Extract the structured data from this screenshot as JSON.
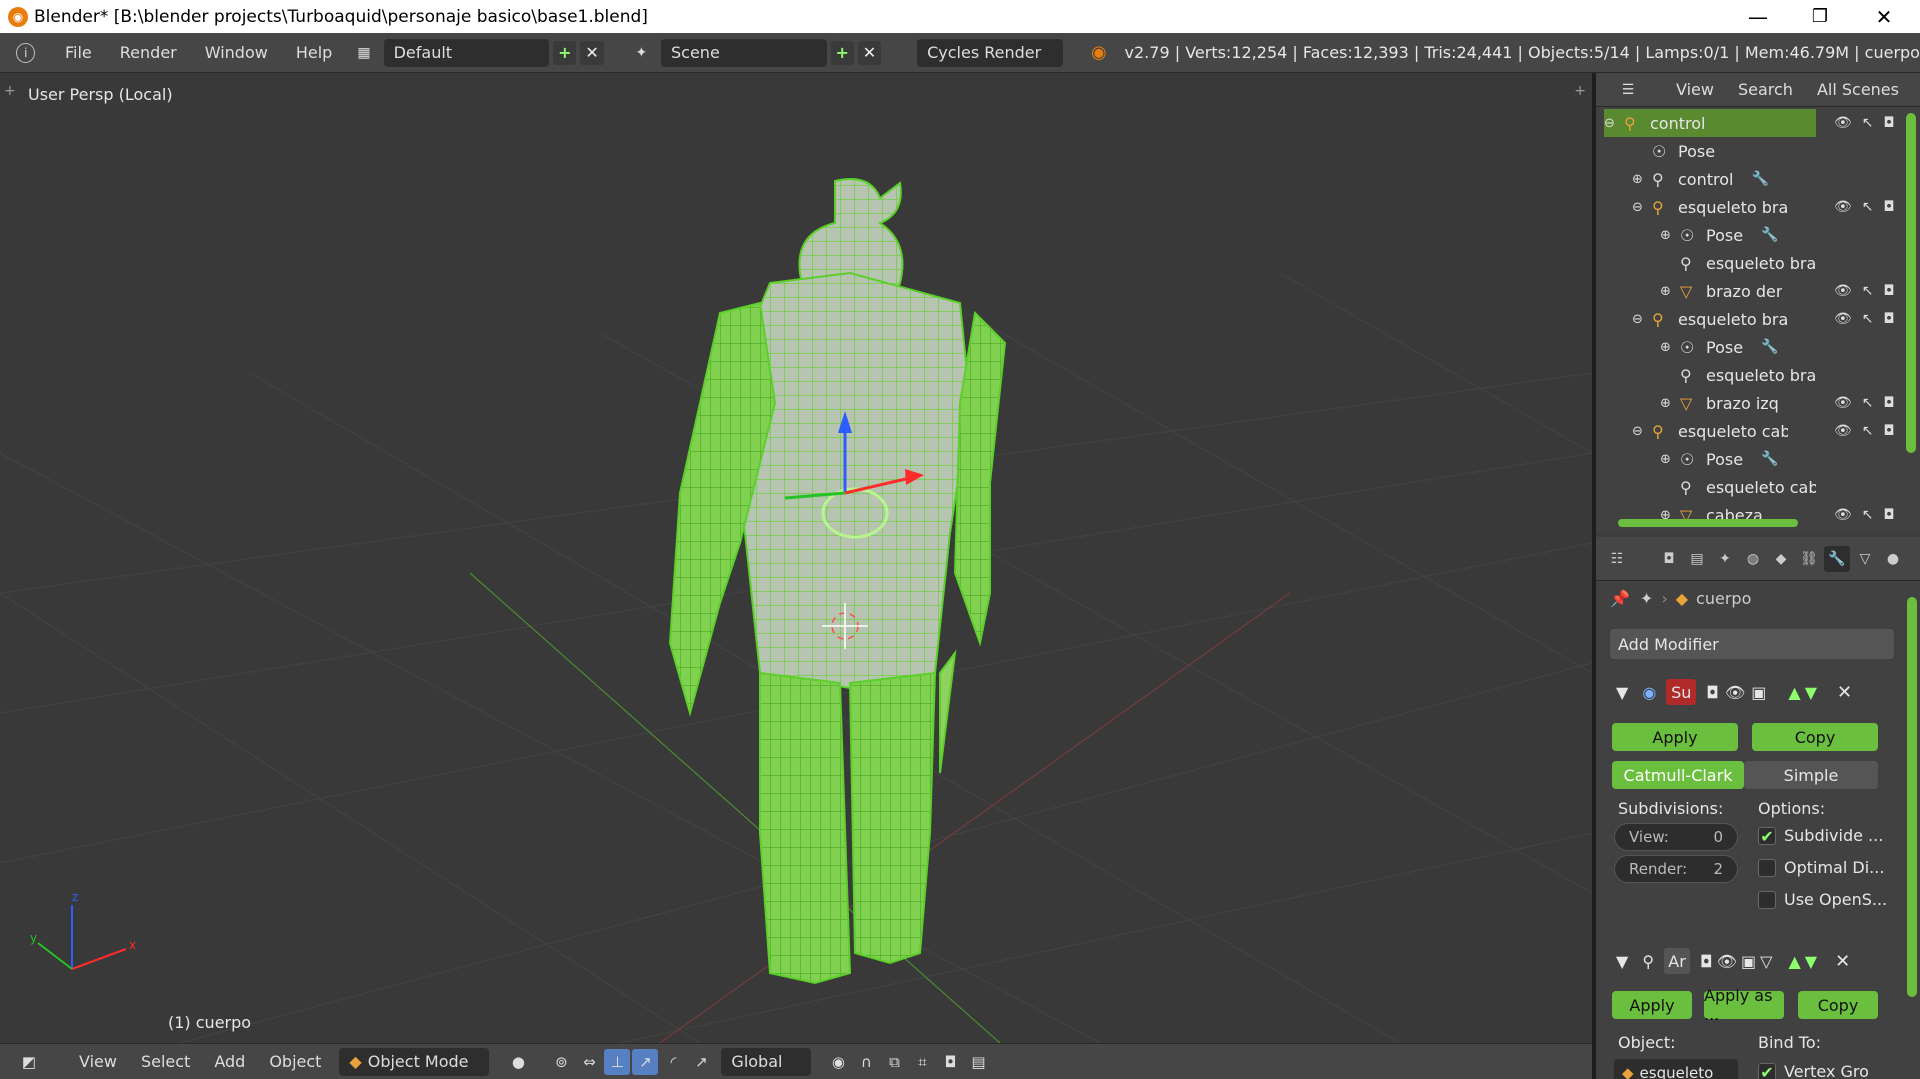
{
  "window": {
    "title": "Blender* [B:\\blender projects\\Turboaquid\\personaje basico\\base1.blend]",
    "minimize": "—",
    "maximize": "❐",
    "close": "✕"
  },
  "topbar": {
    "menus": [
      "File",
      "Render",
      "Window",
      "Help"
    ],
    "layout": "Default",
    "scene": "Scene",
    "engine": "Cycles Render",
    "stats": "v2.79 | Verts:12,254 | Faces:12,393 | Tris:24,441 | Objects:5/14 | Lamps:0/1 | Mem:46.79M | cuerpo",
    "add": "+",
    "remove": "✕"
  },
  "viewport": {
    "label": "User Persp (Local)",
    "object": "(1) cuerpo",
    "axes": {
      "x": "x",
      "y": "y",
      "z": "z"
    },
    "accent": "#7bd44a"
  },
  "bottombar": {
    "menus": [
      "View",
      "Select",
      "Add",
      "Object"
    ],
    "mode": "Object Mode",
    "orientation": "Global"
  },
  "outliner": {
    "tabs": [
      "View",
      "Search",
      "All Scenes"
    ],
    "rows": [
      {
        "label": "control",
        "indent": 0,
        "icon": "armature-icon",
        "selected": true,
        "expander": "⊖",
        "vis": true
      },
      {
        "label": "Pose",
        "indent": 1,
        "icon": "pose-icon",
        "selected": false,
        "expander": "",
        "vis": false
      },
      {
        "label": "control",
        "indent": 1,
        "icon": "armature-data-icon",
        "selected": false,
        "expander": "⊕",
        "vis": false,
        "extra": "wrench"
      },
      {
        "label": "esqueleto brazo de",
        "indent": 1,
        "icon": "armature-icon",
        "selected": false,
        "expander": "⊖",
        "vis": true
      },
      {
        "label": "Pose",
        "indent": 2,
        "icon": "pose-icon",
        "selected": false,
        "expander": "⊕",
        "vis": false,
        "extra": "wrench"
      },
      {
        "label": "esqueleto braz",
        "indent": 2,
        "icon": "armature-data-icon",
        "selected": false,
        "expander": "",
        "vis": false
      },
      {
        "label": "brazo der",
        "indent": 2,
        "icon": "mesh-icon",
        "selected": false,
        "expander": "⊕",
        "vis": true
      },
      {
        "label": "esqueleto brazo izc",
        "indent": 1,
        "icon": "armature-icon",
        "selected": false,
        "expander": "⊖",
        "vis": true
      },
      {
        "label": "Pose",
        "indent": 2,
        "icon": "pose-icon",
        "selected": false,
        "expander": "⊕",
        "vis": false,
        "extra": "wrench"
      },
      {
        "label": "esqueleto braz",
        "indent": 2,
        "icon": "armature-data-icon",
        "selected": false,
        "expander": "",
        "vis": false
      },
      {
        "label": "brazo izq",
        "indent": 2,
        "icon": "mesh-icon",
        "selected": false,
        "expander": "⊕",
        "vis": true
      },
      {
        "label": "esqueleto cabeza",
        "indent": 1,
        "icon": "armature-icon",
        "selected": false,
        "expander": "⊖",
        "vis": true
      },
      {
        "label": "Pose",
        "indent": 2,
        "icon": "pose-icon",
        "selected": false,
        "expander": "⊕",
        "vis": false,
        "extra": "wrench"
      },
      {
        "label": "esqueleto cabe",
        "indent": 2,
        "icon": "armature-data-icon",
        "selected": false,
        "expander": "",
        "vis": false
      },
      {
        "label": "cabeza",
        "indent": 2,
        "icon": "mesh-icon",
        "selected": false,
        "expander": "⊕",
        "vis": true
      }
    ]
  },
  "properties": {
    "object": "cuerpo",
    "add_modifier": "Add Modifier",
    "subsurf": {
      "name": "Su",
      "apply": "Apply",
      "copy": "Copy",
      "catmull": "Catmull-Clark",
      "simple": "Simple",
      "subdivisions": "Subdivisions:",
      "options": "Options:",
      "view_label": "View:",
      "view_value": "0",
      "render_label": "Render:",
      "render_value": "2",
      "opt1": "Subdivide ...",
      "opt2": "Optimal Di...",
      "opt3": "Use OpenS..."
    },
    "armature": {
      "name": "Ar",
      "apply": "Apply",
      "apply_as": "Apply as ...",
      "copy": "Copy",
      "object_label": "Object:",
      "bind_label": "Bind To:",
      "object_value": "esqueleto",
      "bind_value": "Vertex Gro"
    }
  }
}
